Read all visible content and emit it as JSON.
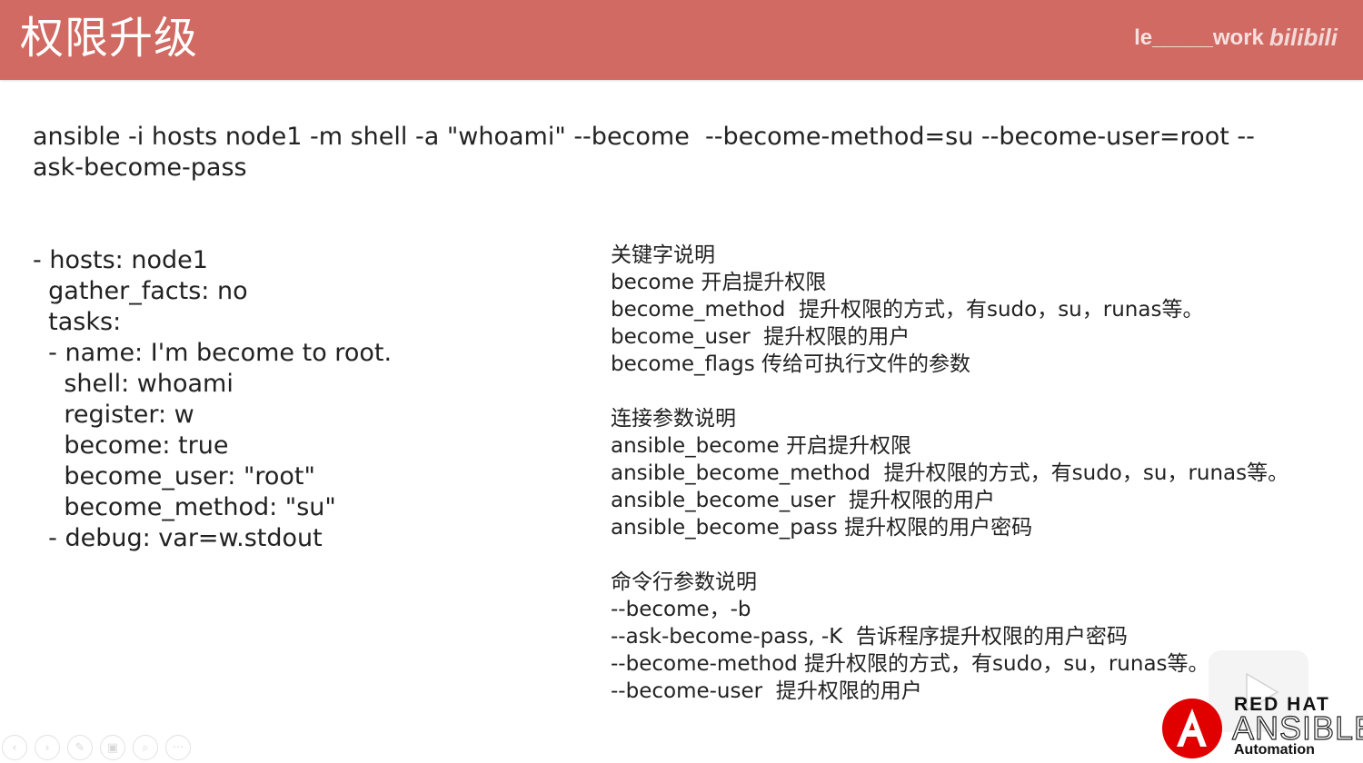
{
  "header": {
    "title": "权限升级",
    "watermark": "le_____work",
    "platform_logo": "bilibili",
    "background_color": "#d06a63"
  },
  "command_line": "ansible -i hosts node1 -m shell -a \"whoami\" --become  --become-method=su --become-user=root --ask-become-pass",
  "playbook_lines": [
    "- hosts: node1",
    "  gather_facts: no",
    "  tasks:",
    "  - name: I'm become to root.",
    "    shell: whoami",
    "    register: w",
    "    become: true",
    "    become_user: \"root\"",
    "    become_method: \"su\"",
    "  - debug: var=w.stdout"
  ],
  "explanations": [
    {
      "heading": "关键字说明",
      "lines": [
        "become 开启提升权限",
        "become_method  提升权限的方式，有sudo，su，runas等。",
        "become_user  提升权限的用户",
        "become_flags 传给可执行文件的参数"
      ]
    },
    {
      "heading": "连接参数说明",
      "lines": [
        "ansible_become 开启提升权限",
        "ansible_become_method  提升权限的方式，有sudo，su，runas等。",
        "ansible_become_user  提升权限的用户",
        "ansible_become_pass 提升权限的用户密码"
      ]
    },
    {
      "heading": "命令行参数说明",
      "lines": [
        "--become，-b",
        "--ask-become-pass, -K  告诉程序提升权限的用户密码",
        "--become-method 提升权限的方式，有sudo，su，runas等。",
        "--become-user  提升权限的用户"
      ]
    }
  ],
  "toolbar": {
    "icons": [
      "prev-icon",
      "next-icon",
      "pen-icon",
      "slides-icon",
      "zoom-icon",
      "more-icon"
    ],
    "glyphs": [
      "‹",
      "›",
      "✎",
      "▣",
      "⌕",
      "···"
    ]
  },
  "redhat_logo": {
    "line1": "RED HAT",
    "line2": "ANSIBLE",
    "line3": "Automation"
  }
}
